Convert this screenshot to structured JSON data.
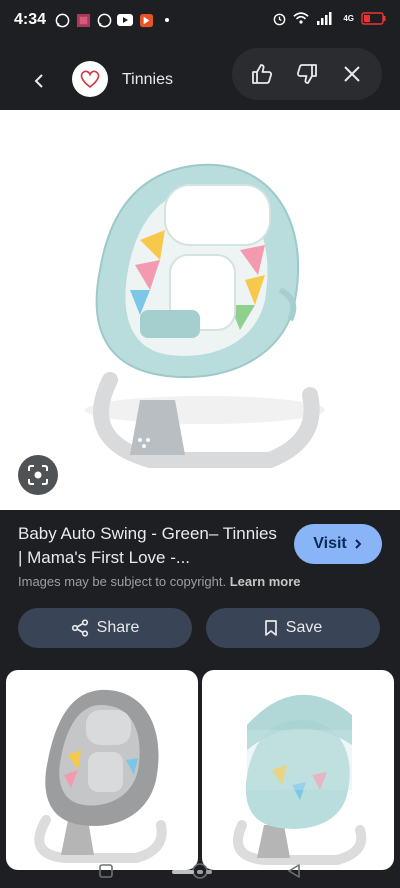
{
  "status_bar": {
    "time": "4:34",
    "network": "4G",
    "icons": [
      "whatsapp-icon",
      "photo-icon",
      "whatsapp-icon",
      "youtube-icon",
      "app-icon",
      "dot-icon",
      "alarm-icon",
      "wifi-icon",
      "signal-icon",
      "battery-icon"
    ]
  },
  "header": {
    "site_name": "Tinnies"
  },
  "result": {
    "title": "Baby Auto Swing - Green– Tinnies | Mama's First Love -...",
    "visit_label": "Visit",
    "copyright_text": "Images may be subject to copyright.",
    "learn_more": "Learn more"
  },
  "actions": {
    "share_label": "Share",
    "save_label": "Save"
  },
  "colors": {
    "background": "#1e1f22",
    "accent": "#8ab4f8",
    "button": "#394457"
  }
}
